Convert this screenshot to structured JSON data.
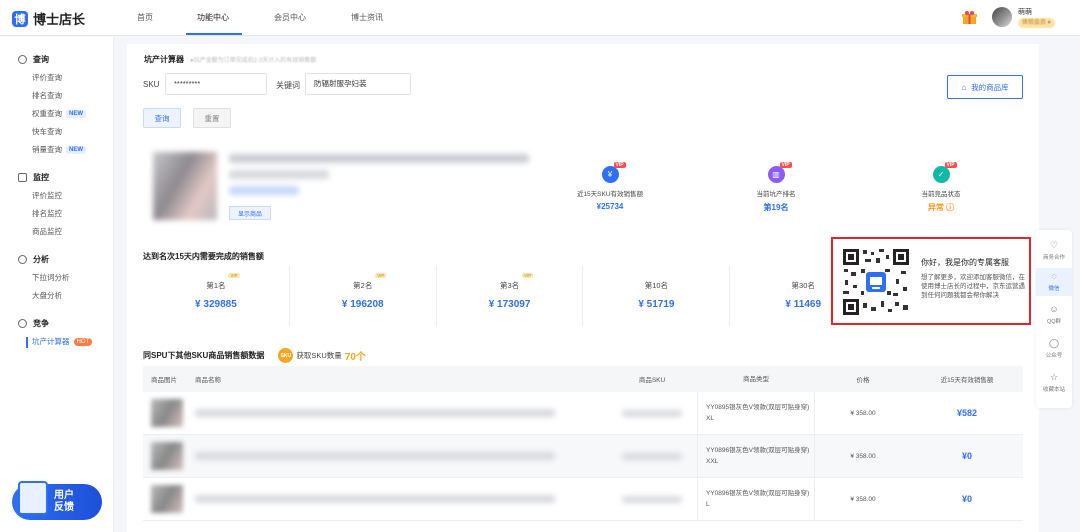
{
  "app": {
    "logo_mark": "博",
    "logo_text": "博士店长"
  },
  "nav": {
    "tabs": [
      "首页",
      "功能中心",
      "会员中心",
      "博士资讯"
    ]
  },
  "user": {
    "name": "萌萌",
    "badge": "体验会员 ▾"
  },
  "sidebar": {
    "groups": [
      {
        "label": "查询",
        "icon": "search-icon",
        "items": [
          {
            "label": "评价查询"
          },
          {
            "label": "排名查询"
          },
          {
            "label": "权重查询",
            "badge": "NEW"
          },
          {
            "label": "快车查询"
          },
          {
            "label": "销量查询",
            "badge": "NEW"
          }
        ]
      },
      {
        "label": "监控",
        "icon": "monitor-icon",
        "items": [
          {
            "label": "评价监控"
          },
          {
            "label": "排名监控"
          },
          {
            "label": "商品监控"
          }
        ]
      },
      {
        "label": "分析",
        "icon": "analysis-icon",
        "items": [
          {
            "label": "下拉词分析"
          },
          {
            "label": "大盘分析"
          }
        ]
      },
      {
        "label": "竞争",
        "icon": "compete-icon",
        "items": [
          {
            "label": "坑产计算器",
            "badge": "HOT",
            "active": true
          }
        ]
      }
    ],
    "feedback": {
      "line1": "用户",
      "line2": "反馈"
    }
  },
  "calculator": {
    "title": "坑产计算器",
    "note": "●坑产金额为订单完成后2-3天计入的有效销售额",
    "sku_label": "SKU",
    "sku_value": "*********",
    "keyword_label": "关键词",
    "keyword_value": "防辐射服孕妇装",
    "query_btn": "查询",
    "reset_btn": "重置",
    "my_products_btn": "我的商品库",
    "show_product_btn": "显示商品"
  },
  "stats": [
    {
      "label": "近15天SKU有效销售额",
      "value": "¥25734",
      "icon": "yen-icon",
      "vip": "VIP",
      "color": "#2f6ff2"
    },
    {
      "label": "当前坑产排名",
      "value": "第19名",
      "icon": "rank-icon",
      "vip": "VIP",
      "color": "#8b5cf6"
    },
    {
      "label": "当前竞品状态",
      "value": "异常 ⓘ",
      "icon": "status-icon",
      "vip": "VIP",
      "color": "#10b9a6"
    }
  ],
  "target": {
    "title": "达到名次15天内需要完成的销售额",
    "ranks": [
      {
        "label": "第1名",
        "value": "¥ 329885",
        "vip": "VIP"
      },
      {
        "label": "第2名",
        "value": "¥ 196208",
        "vip": "VIP"
      },
      {
        "label": "第3名",
        "value": "¥ 173097",
        "vip": "VIP"
      },
      {
        "label": "第10名",
        "value": "¥ 51719"
      },
      {
        "label": "第30名",
        "value": "¥ 11469"
      },
      {
        "label": "第",
        "value": "¥ 5"
      }
    ]
  },
  "spu": {
    "title": "同SPU下其他SKU商品销售额数据",
    "badge": "SKU",
    "count_label": "获取SKU数量",
    "count": "70个",
    "columns": [
      "商品图片",
      "商品名称",
      "商品SKU",
      "商品类型",
      "价格",
      "近15天有效销售额"
    ],
    "rows": [
      {
        "type": "YY0895银灰色V领款(双层可贴身穿) XL",
        "price": "¥ 358.00",
        "sales": "¥582"
      },
      {
        "type": "YY0896银灰色V领款(双层可贴身穿) XXL",
        "price": "¥ 358.00",
        "sales": "¥0"
      },
      {
        "type": "YY0896银灰色V领款(双层可贴身穿) L",
        "price": "¥ 358.00",
        "sales": "¥0"
      }
    ]
  },
  "popup": {
    "title": "你好，我是你的专属客服",
    "desc": "想了解更多，欢迎添加客服微信，在使用博士店长的过程中，京东运营遇到任何问题我都会帮你解决"
  },
  "floatbar": [
    {
      "label": "商务合作",
      "icon": "handshake-icon"
    },
    {
      "label": "微信",
      "icon": "wechat-icon",
      "active": true
    },
    {
      "label": "QQ群",
      "icon": "qq-icon"
    },
    {
      "label": "公众号",
      "icon": "chat-icon"
    },
    {
      "label": "收藏本站",
      "icon": "star-icon"
    }
  ]
}
